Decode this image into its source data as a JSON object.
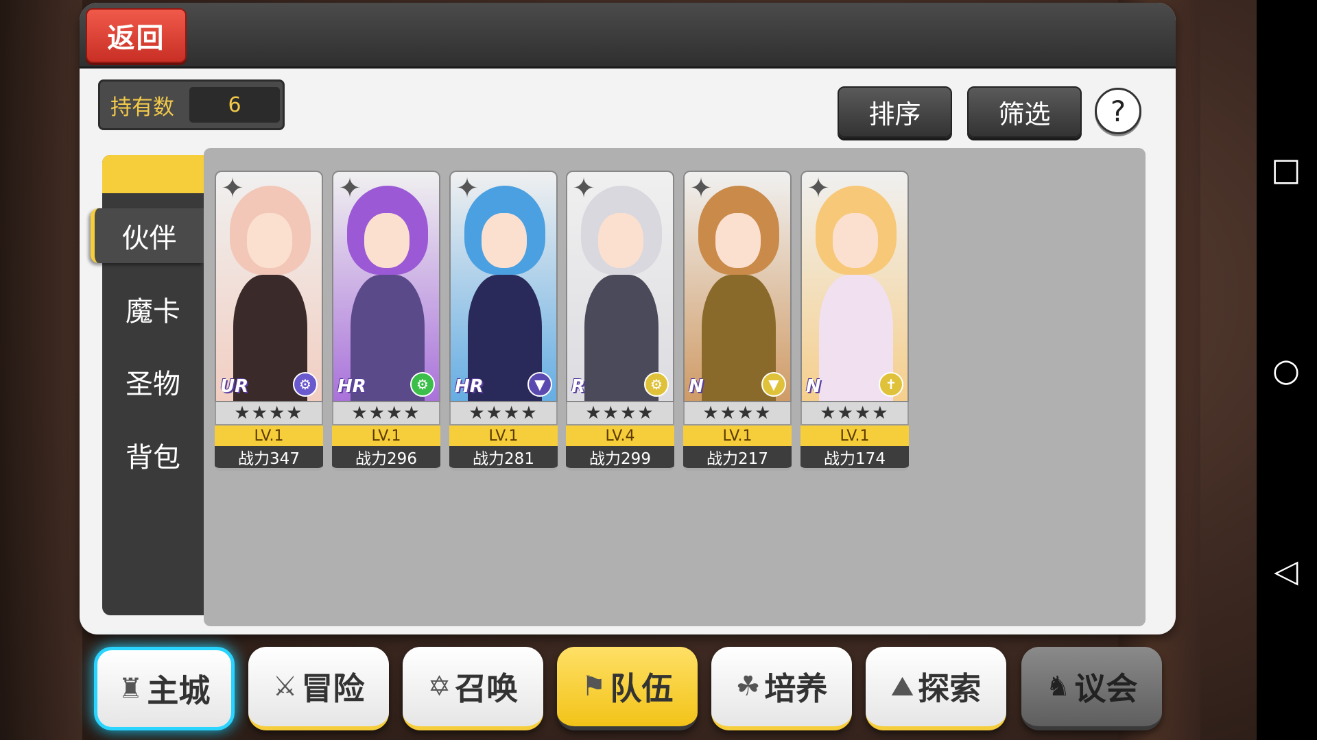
{
  "header": {
    "back_label": "返回"
  },
  "owned": {
    "label": "持有数",
    "value": "6"
  },
  "toolbar": {
    "sort_label": "排序",
    "filter_label": "筛选",
    "help_label": "?"
  },
  "side_tabs": [
    {
      "label": "伙伴",
      "active": true
    },
    {
      "label": "魔卡",
      "active": false
    },
    {
      "label": "圣物",
      "active": false
    },
    {
      "label": "背包",
      "active": false
    }
  ],
  "cards": [
    {
      "rarity": "UR",
      "stars": "★★★★",
      "level": "LV.1",
      "power": "战力347",
      "hair": "#f2c7b8",
      "outfit": "#3a2a2a",
      "elem_color": "#6a5acd",
      "elem_icon": "gear-icon"
    },
    {
      "rarity": "HR",
      "stars": "★★★★",
      "level": "LV.1",
      "power": "战力296",
      "hair": "#9b59d6",
      "outfit": "#5b4a8a",
      "elem_color": "#3bbf4a",
      "elem_icon": "gear-icon"
    },
    {
      "rarity": "HR",
      "stars": "★★★★",
      "level": "LV.1",
      "power": "战力281",
      "hair": "#4aa0e0",
      "outfit": "#2a2a5a",
      "elem_color": "#5a4ab0",
      "elem_icon": "triangle-icon"
    },
    {
      "rarity": "R",
      "stars": "★★★★",
      "level": "LV.4",
      "power": "战力299",
      "hair": "#d8d8de",
      "outfit": "#4a4a5a",
      "elem_color": "#e0c23a",
      "elem_icon": "gear-icon"
    },
    {
      "rarity": "N",
      "stars": "★★★★",
      "level": "LV.1",
      "power": "战力217",
      "hair": "#c98a4a",
      "outfit": "#8a6a2a",
      "elem_color": "#e0c23a",
      "elem_icon": "triangle-icon"
    },
    {
      "rarity": "N",
      "stars": "★★★★",
      "level": "LV.1",
      "power": "战力174",
      "hair": "#f7c878",
      "outfit": "#f0e0f0",
      "elem_color": "#e0c23a",
      "elem_icon": "cross-icon"
    }
  ],
  "bottom_nav": [
    {
      "label": "主城",
      "icon": "castle-icon"
    },
    {
      "label": "冒险",
      "icon": "crossed-swords-icon"
    },
    {
      "label": "召唤",
      "icon": "hexagram-icon"
    },
    {
      "label": "队伍",
      "icon": "banner-icon"
    },
    {
      "label": "培养",
      "icon": "trinity-icon"
    },
    {
      "label": "探索",
      "icon": "explore-icon"
    },
    {
      "label": "议会",
      "icon": "dragon-icon"
    }
  ],
  "colors": {
    "accent": "#f6cd3a",
    "back_red": "#e0443a",
    "home_glow": "#29d4ff"
  }
}
